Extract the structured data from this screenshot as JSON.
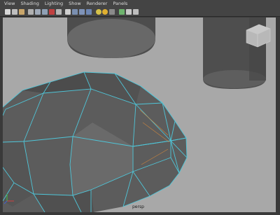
{
  "menubar": {
    "items": [
      {
        "label": "View"
      },
      {
        "label": "Shading"
      },
      {
        "label": "Lighting"
      },
      {
        "label": "Show"
      },
      {
        "label": "Renderer"
      },
      {
        "label": "Panels"
      }
    ]
  },
  "toolbar": {
    "icons": [
      {
        "name": "select-camera-icon",
        "color": "#d8d8d8"
      },
      {
        "name": "camera-attributes-icon",
        "color": "#bfbfbf"
      },
      {
        "name": "bookmark-icon",
        "color": "#c9a66b"
      },
      {
        "name": "image-plane-icon",
        "color": "#b0b0b0"
      },
      {
        "name": "grid-icon",
        "color": "#9fa9b8"
      },
      {
        "name": "film-gate-icon",
        "color": "#8fa0b5"
      },
      {
        "name": "resolution-gate-icon",
        "color": "#c04040"
      },
      {
        "name": "safe-action-icon",
        "color": "#b5b5b5"
      },
      {
        "name": "wireframe-icon",
        "color": "#cfcfcf"
      },
      {
        "name": "smooth-shade-icon",
        "color": "#7a8fb0"
      },
      {
        "name": "flat-shade-icon",
        "color": "#7f93b8"
      },
      {
        "name": "textured-icon",
        "color": "#6d86b3"
      },
      {
        "name": "default-light-icon",
        "color": "#d6c24a"
      },
      {
        "name": "all-lights-icon",
        "color": "#e0b030"
      },
      {
        "name": "shadows-icon",
        "color": "#8a8a8a"
      },
      {
        "name": "xray-icon",
        "color": "#6db36d"
      },
      {
        "name": "isolate-select-icon",
        "color": "#c8c8c8"
      },
      {
        "name": "hud-icon",
        "color": "#bdbdbd"
      }
    ]
  },
  "viewport": {
    "camera_label": "persp",
    "background": "#a8a8a8",
    "wire_color": "#4fc6d9",
    "face_color": "#5a5a5a",
    "highlight_edge_color": "#d98a3a"
  }
}
